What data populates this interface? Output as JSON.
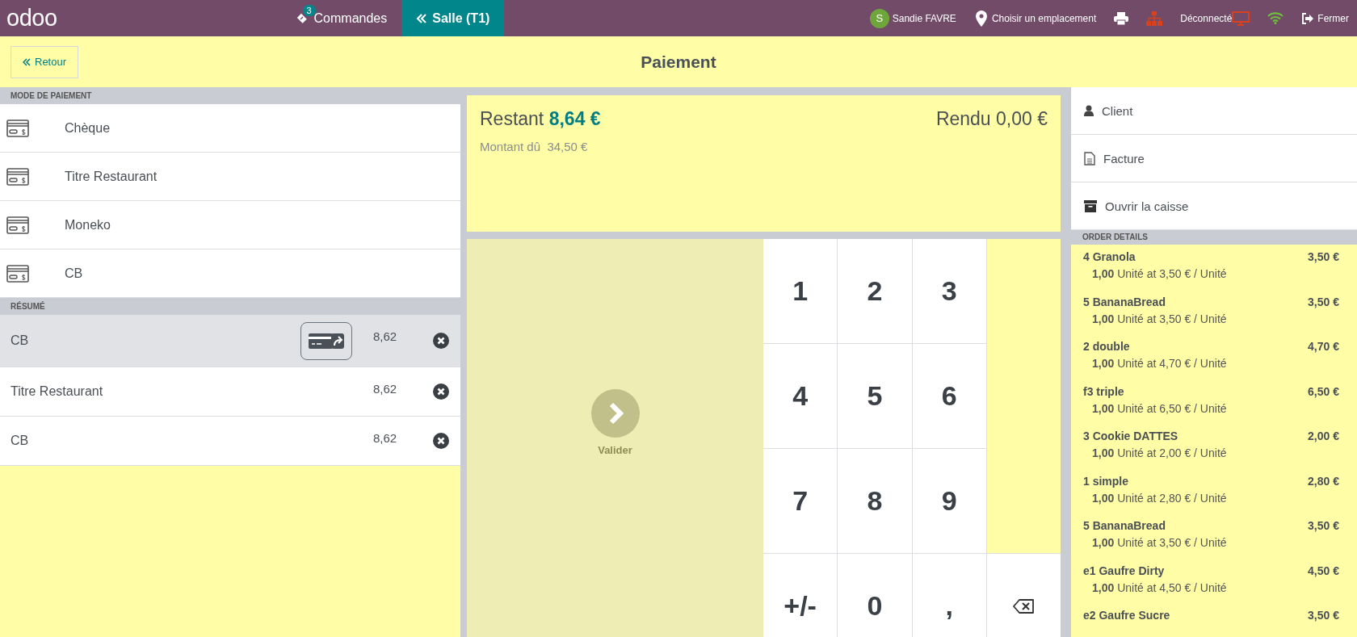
{
  "topbar": {
    "logo": "odoo",
    "tabs": [
      {
        "kind": "orders",
        "label": "Commandes",
        "badge": "3",
        "selected": false
      },
      {
        "kind": "floor",
        "label": "Salle (T1)",
        "selected": true
      }
    ],
    "user": {
      "initial": "S",
      "name": "Sandie FAVRE"
    },
    "location": "Choisir un emplacement",
    "connection": "Déconnecté",
    "close": "Fermer"
  },
  "header": {
    "back": "Retour",
    "title": "Paiement"
  },
  "payment_methods": {
    "header": "MODE DE PAIEMENT",
    "items": [
      "Chèque",
      "Titre Restaurant",
      "Moneko",
      "CB"
    ]
  },
  "summary": {
    "header": "RÉSUMÉ",
    "lines": [
      {
        "name": "CB",
        "amount": "8,62",
        "selected": true,
        "kind": "terminal"
      },
      {
        "name": "Titre Restaurant",
        "amount": "8,62",
        "selected": false,
        "kind": "plain"
      },
      {
        "name": "CB",
        "amount": "8,62",
        "selected": false,
        "kind": "plain"
      }
    ]
  },
  "status": {
    "remaining_label": "Restant",
    "remaining": "8,64 €",
    "change_label": "Rendu",
    "change": "0,00 €",
    "due_label": "Montant dû",
    "due": "34,50 €"
  },
  "validate": "Valider",
  "keypad": [
    "1",
    "2",
    "3",
    "4",
    "5",
    "6",
    "7",
    "8",
    "9",
    "+/-",
    "0",
    ","
  ],
  "actions": [
    {
      "kind": "client",
      "label": "Client"
    },
    {
      "kind": "invoice",
      "label": "Facture"
    },
    {
      "kind": "cashbox",
      "label": "Ouvrir la caisse"
    }
  ],
  "order_details": {
    "header": "ORDER DETAILS",
    "lines": [
      {
        "name": "4 Granola",
        "price": "3,50 €",
        "detail": "**1,00** Unité at 3,50 € / Unité"
      },
      {
        "name": "5 BananaBread",
        "price": "3,50 €",
        "detail": "**1,00** Unité at 3,50 € / Unité"
      },
      {
        "name": "2 double",
        "price": "4,70 €",
        "detail": "**1,00** Unité at 4,70 € / Unité"
      },
      {
        "name": "f3 triple",
        "price": "6,50 €",
        "detail": "**1,00** Unité at 6,50 € / Unité"
      },
      {
        "name": "3 Cookie DATTES",
        "price": "2,00 €",
        "detail": "**1,00** Unité at 2,00 € / Unité"
      },
      {
        "name": "1 simple",
        "price": "2,80 €",
        "detail": "**1,00** Unité at 2,80 € / Unité"
      },
      {
        "name": "5 BananaBread",
        "price": "3,50 €",
        "detail": "**1,00** Unité at 3,50 € / Unité"
      },
      {
        "name": "e1 Gaufre Dirty",
        "price": "4,50 €",
        "detail": "**1,00** Unité at 4,50 € / Unité"
      },
      {
        "name": "e2 Gaufre Sucre",
        "price": "3,50 €"
      }
    ]
  }
}
